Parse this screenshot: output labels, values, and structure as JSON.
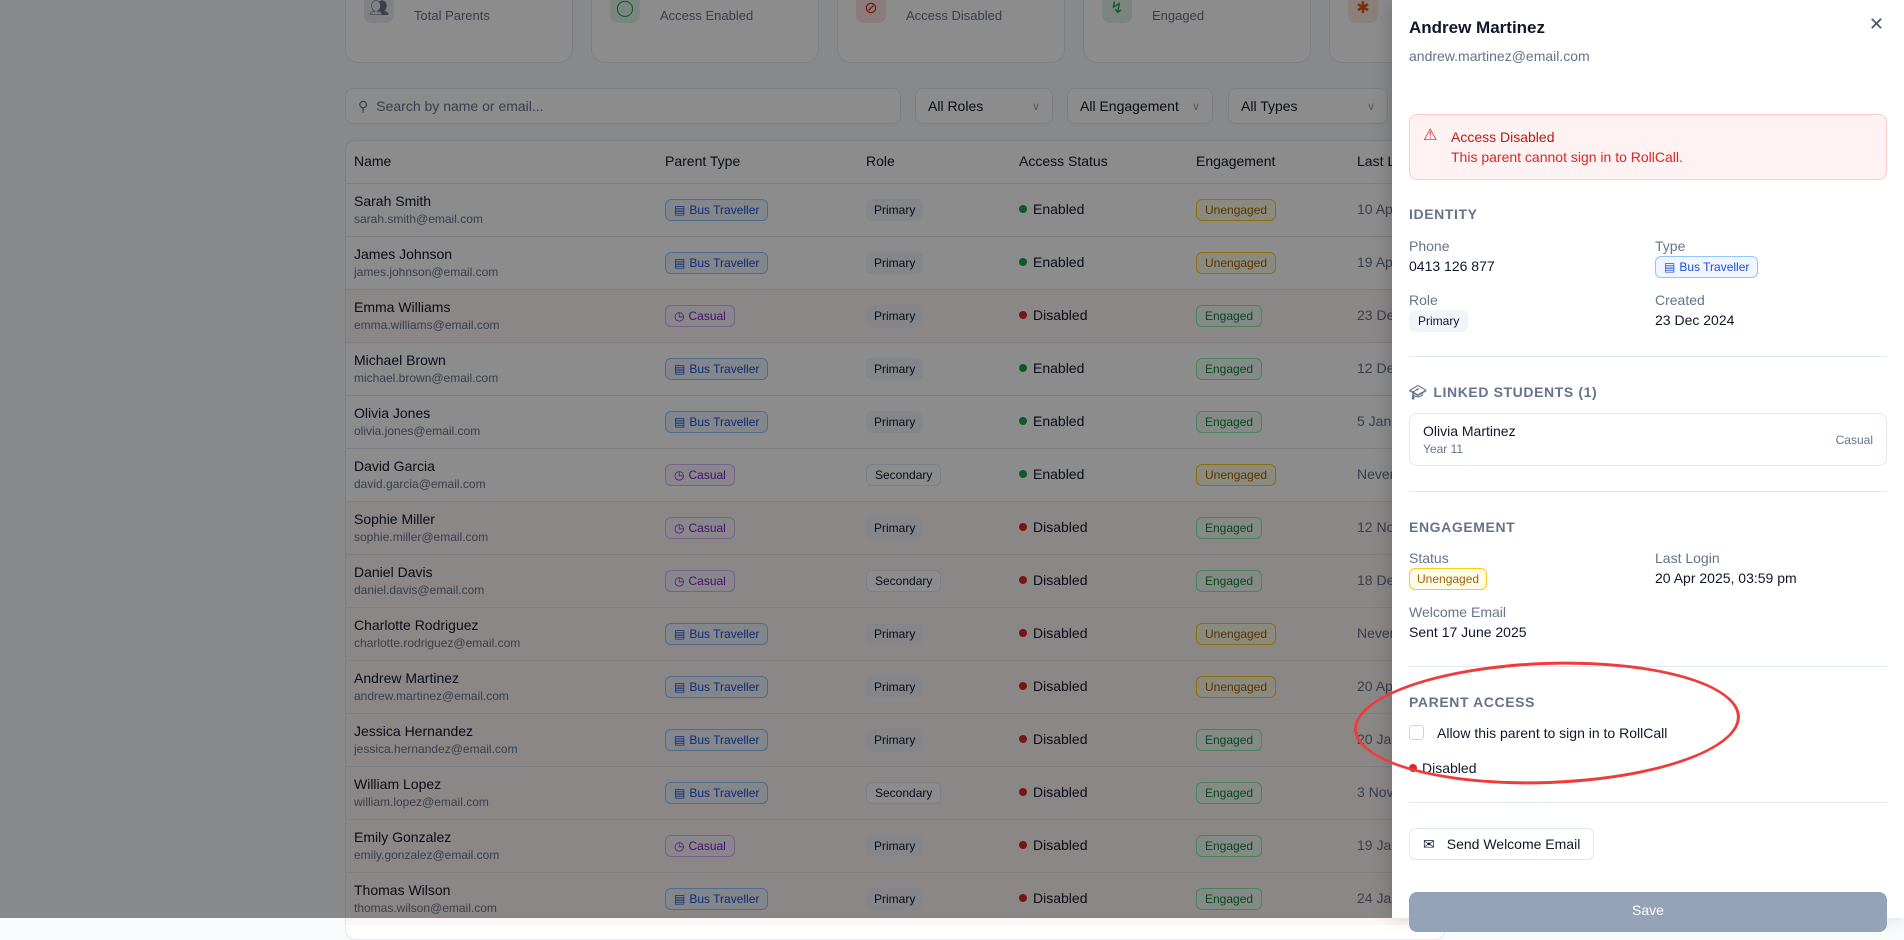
{
  "stats": [
    {
      "label": "Total Parents",
      "icon": "users-icon",
      "color": "#64748b"
    },
    {
      "label": "Access Enabled",
      "icon": "shield-check-icon",
      "color": "#16a34a"
    },
    {
      "label": "Access Disabled",
      "icon": "shield-off-icon",
      "color": "#dc2626"
    },
    {
      "label": "Engaged",
      "icon": "activity-icon",
      "color": "#16a34a"
    },
    {
      "label": "",
      "icon": "user-x-icon",
      "color": "#ea580c"
    }
  ],
  "filters": {
    "search_placeholder": "Search by name or email...",
    "roles": "All Roles",
    "engagement": "All Engagement",
    "types": "All Types"
  },
  "table": {
    "headers": [
      "Name",
      "Parent Type",
      "Role",
      "Access Status",
      "Engagement",
      "Last L"
    ],
    "rows": [
      {
        "name": "Sarah Smith",
        "email": "sarah.smith@email.com",
        "type": "Bus Traveller",
        "role": "Primary",
        "access": "Enabled",
        "engagement": "Unengaged",
        "last": "10 Ap"
      },
      {
        "name": "James Johnson",
        "email": "james.johnson@email.com",
        "type": "Bus Traveller",
        "role": "Primary",
        "access": "Enabled",
        "engagement": "Unengaged",
        "last": "19 Ap"
      },
      {
        "name": "Emma Williams",
        "email": "emma.williams@email.com",
        "type": "Casual",
        "role": "Primary",
        "access": "Disabled",
        "engagement": "Engaged",
        "last": "23 De"
      },
      {
        "name": "Michael Brown",
        "email": "michael.brown@email.com",
        "type": "Bus Traveller",
        "role": "Primary",
        "access": "Enabled",
        "engagement": "Engaged",
        "last": "12 De"
      },
      {
        "name": "Olivia Jones",
        "email": "olivia.jones@email.com",
        "type": "Bus Traveller",
        "role": "Primary",
        "access": "Enabled",
        "engagement": "Engaged",
        "last": "5 Jan"
      },
      {
        "name": "David Garcia",
        "email": "david.garcia@email.com",
        "type": "Casual",
        "role": "Secondary",
        "access": "Enabled",
        "engagement": "Unengaged",
        "last": "Never"
      },
      {
        "name": "Sophie Miller",
        "email": "sophie.miller@email.com",
        "type": "Casual",
        "role": "Primary",
        "access": "Disabled",
        "engagement": "Engaged",
        "last": "12 No"
      },
      {
        "name": "Daniel Davis",
        "email": "daniel.davis@email.com",
        "type": "Casual",
        "role": "Secondary",
        "access": "Disabled",
        "engagement": "Engaged",
        "last": "18 De"
      },
      {
        "name": "Charlotte Rodriguez",
        "email": "charlotte.rodriguez@email.com",
        "type": "Bus Traveller",
        "role": "Primary",
        "access": "Disabled",
        "engagement": "Unengaged",
        "last": "Never"
      },
      {
        "name": "Andrew Martinez",
        "email": "andrew.martinez@email.com",
        "type": "Bus Traveller",
        "role": "Primary",
        "access": "Disabled",
        "engagement": "Unengaged",
        "last": "20 Ap"
      },
      {
        "name": "Jessica Hernandez",
        "email": "jessica.hernandez@email.com",
        "type": "Bus Traveller",
        "role": "Primary",
        "access": "Disabled",
        "engagement": "Engaged",
        "last": "20 Ja"
      },
      {
        "name": "William Lopez",
        "email": "william.lopez@email.com",
        "type": "Bus Traveller",
        "role": "Secondary",
        "access": "Disabled",
        "engagement": "Engaged",
        "last": "3 Nov"
      },
      {
        "name": "Emily Gonzalez",
        "email": "emily.gonzalez@email.com",
        "type": "Casual",
        "role": "Primary",
        "access": "Disabled",
        "engagement": "Engaged",
        "last": "19 Ja"
      },
      {
        "name": "Thomas Wilson",
        "email": "thomas.wilson@email.com",
        "type": "Bus Traveller",
        "role": "Primary",
        "access": "Disabled",
        "engagement": "Engaged",
        "last": "24 Ja"
      }
    ]
  },
  "panel": {
    "name": "Andrew Martinez",
    "email": "andrew.martinez@email.com",
    "alert": {
      "title": "Access Disabled",
      "message": "This parent cannot sign in to RollCall."
    },
    "identity": {
      "heading": "IDENTITY",
      "phone_label": "Phone",
      "phone": "0413 126 877",
      "type_label": "Type",
      "type": "Bus Traveller",
      "role_label": "Role",
      "role": "Primary",
      "created_label": "Created",
      "created": "23 Dec 2024"
    },
    "linked": {
      "heading": "LINKED STUDENTS (1)",
      "students": [
        {
          "name": "Olivia Martinez",
          "year": "Year 11",
          "type": "Casual"
        }
      ]
    },
    "engagement": {
      "heading": "ENGAGEMENT",
      "status_label": "Status",
      "status": "Unengaged",
      "last_login_label": "Last Login",
      "last_login": "20 Apr 2025, 03:59 pm",
      "welcome_label": "Welcome Email",
      "welcome": "Sent 17 June 2025"
    },
    "access": {
      "heading": "PARENT ACCESS",
      "checkbox_label": "Allow this parent to sign in to RollCall",
      "checked": false,
      "status": "Disabled"
    },
    "send_button": "Send Welcome Email",
    "save_button": "Save"
  },
  "colors": {
    "enabled": "#16a34a",
    "disabled": "#dc2626",
    "annotation": "#ef3b3b",
    "save": "#94a3b8"
  }
}
